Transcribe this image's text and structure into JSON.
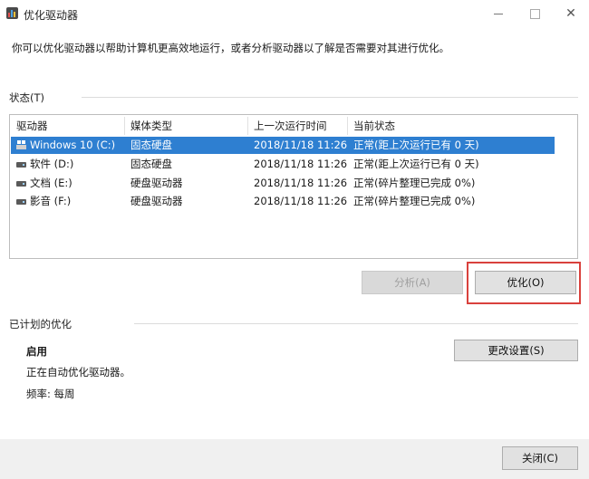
{
  "window": {
    "title": "优化驱动器",
    "minimize": "—",
    "maximize": "",
    "close": "✕"
  },
  "description": "你可以优化驱动器以帮助计算机更高效地运行，或者分析驱动器以了解是否需要对其进行优化。",
  "status": {
    "label": "状态(T)",
    "columns": [
      "驱动器",
      "媒体类型",
      "上一次运行时间",
      "当前状态"
    ],
    "rows": [
      {
        "drive": "Windows 10 (C:)",
        "media": "固态硬盘",
        "last_run": "2018/11/18 11:26",
        "state": "正常(距上次运行已有 0 天)",
        "selected": true,
        "icon": "windows-drive-icon"
      },
      {
        "drive": "软件 (D:)",
        "media": "固态硬盘",
        "last_run": "2018/11/18 11:26",
        "state": "正常(距上次运行已有 0 天)",
        "selected": false,
        "icon": "drive-icon"
      },
      {
        "drive": "文档 (E:)",
        "media": "硬盘驱动器",
        "last_run": "2018/11/18 11:26",
        "state": "正常(碎片整理已完成 0%)",
        "selected": false,
        "icon": "drive-icon"
      },
      {
        "drive": "影音 (F:)",
        "media": "硬盘驱动器",
        "last_run": "2018/11/18 11:26",
        "state": "正常(碎片整理已完成 0%)",
        "selected": false,
        "icon": "drive-icon"
      }
    ],
    "analyze_button": "分析(A)",
    "optimize_button": "优化(O)"
  },
  "scheduled": {
    "label": "已计划的优化",
    "state": "启用",
    "detail": "正在自动优化驱动器。",
    "frequency": "频率: 每周",
    "change_settings_button": "更改设置(S)"
  },
  "footer": {
    "close_button": "关闭(C)"
  },
  "colors": {
    "selection": "#2e7fd1",
    "highlight_border": "#d9413d"
  }
}
